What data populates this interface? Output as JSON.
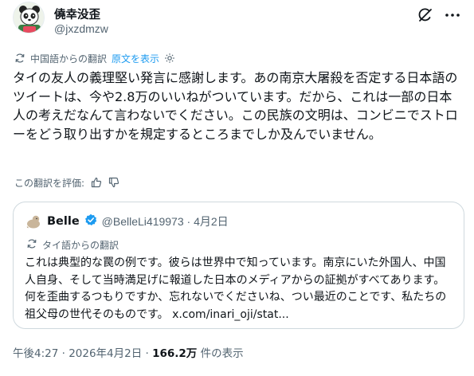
{
  "author": {
    "display_name": "僥幸没歪",
    "handle": "@jxzdmzw",
    "avatar_icon": "panda-avatar-icon"
  },
  "translation": {
    "label": "中国語からの翻訳",
    "show_original": "原文を表示",
    "settings_icon": "gear-icon"
  },
  "tweet_text": "タイの友人の義理堅い発言に感謝します。あの南京大屠殺を否定する日本語のツイートは、今や2.8万のいいねがついています。だから、これは一部の日本人の考えだなんて言わないでください。この民族の文明は、コンビニでストローをどう取り出すかを規定するところまでしか及んでいません。",
  "rate": {
    "label": "この翻訳を評価:",
    "up_icon": "thumbs-up-icon",
    "down_icon": "thumbs-down-icon"
  },
  "quote": {
    "display_name": "Belle",
    "verified_icon": "verified-badge-icon",
    "meta": "@BelleLi419973 · 4月2日",
    "translation_label": "タイ語からの翻訳",
    "text": "これは典型的な罠の例です。彼らは世界中で知っています。南京にいた外国人、中国人自身、そして当時満足げに報道した日本のメディアからの証拠がすべてあります。何を歪曲するつもりですか、忘れないでくださいね、つい最近のことです、私たちの祖父母の世代そのものです。",
    "link": "x.com/inari_oji/stat..."
  },
  "footer": {
    "time": "午後4:27 · 2026年4月2日 · ",
    "views_count": "166.2万",
    "views_label": " 件の表示"
  },
  "colors": {
    "accent": "#1d9bf0",
    "text": "#0f1419",
    "secondary": "#536471",
    "border": "#cfd9de"
  }
}
